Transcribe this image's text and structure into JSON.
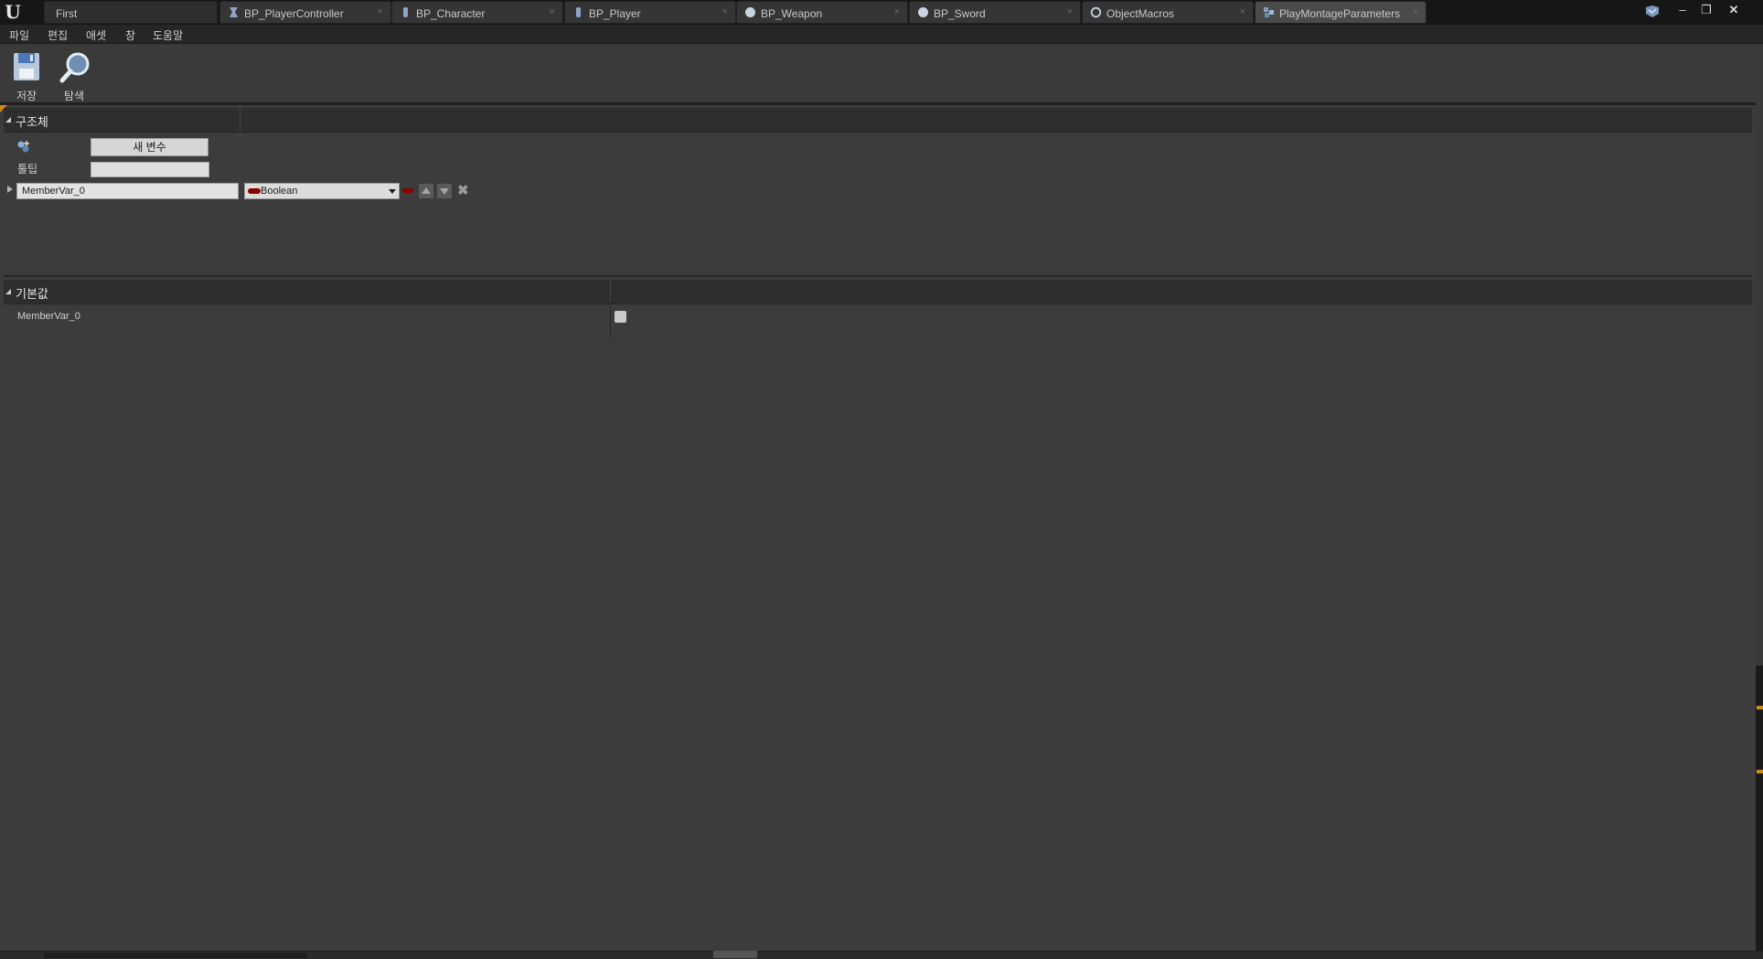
{
  "tabs": {
    "first": "First",
    "items": [
      {
        "label": "BP_PlayerController"
      },
      {
        "label": "BP_Character"
      },
      {
        "label": "BP_Player"
      },
      {
        "label": "BP_Weapon"
      },
      {
        "label": "BP_Sword"
      },
      {
        "label": "ObjectMacros"
      },
      {
        "label": "PlayMontageParameters",
        "active": true
      }
    ],
    "close_glyph": "×"
  },
  "menu": [
    "파일",
    "편집",
    "애셋",
    "창",
    "도움말"
  ],
  "toolbar": {
    "save_label": "저장",
    "browse_label": "탐색"
  },
  "structure": {
    "title": "구조체",
    "new_variable_label": "새 변수",
    "tooltip_label": "툴팁",
    "tooltip_value": "",
    "member": {
      "name": "MemberVar_0",
      "type": "Boolean",
      "type_color": "#8c0000"
    },
    "delete_glyph": "✖"
  },
  "defaults": {
    "title": "기본값",
    "rows": [
      {
        "label": "MemberVar_0",
        "value": false
      }
    ]
  },
  "colors": {
    "accent": "#c88a1a",
    "panel_bg": "#3c3c3c",
    "header_bg": "#2e2e2e"
  }
}
